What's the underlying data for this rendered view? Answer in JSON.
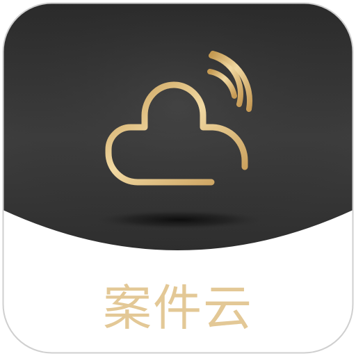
{
  "app": {
    "name": "案件云",
    "icon": "cloud-signal-icon",
    "colors": {
      "dark_background": "#2b2b2b",
      "gold_accent": "#d9b877",
      "label_color": "#e3c896",
      "light_background": "#ffffff"
    }
  }
}
